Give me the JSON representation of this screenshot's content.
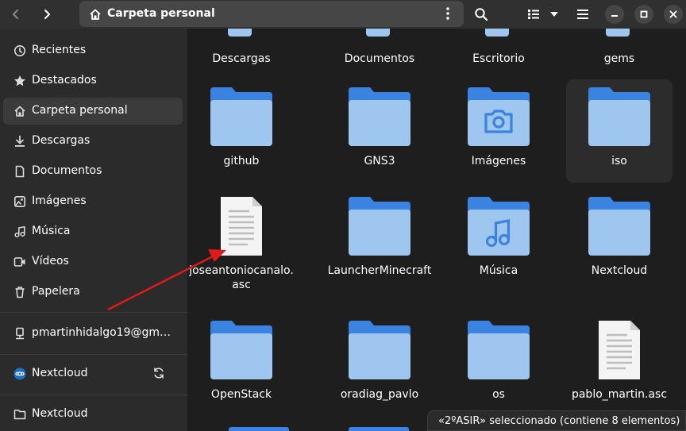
{
  "header": {
    "location_title": "Carpeta personal"
  },
  "sidebar": {
    "items": [
      {
        "label": "Recientes",
        "icon": "clock-icon"
      },
      {
        "label": "Destacados",
        "icon": "star-icon"
      },
      {
        "label": "Carpeta personal",
        "icon": "home-icon",
        "active": true
      },
      {
        "label": "Descargas",
        "icon": "download-icon"
      },
      {
        "label": "Documentos",
        "icon": "document-icon"
      },
      {
        "label": "Imágenes",
        "icon": "image-icon"
      },
      {
        "label": "Música",
        "icon": "music-icon"
      },
      {
        "label": "Vídeos",
        "icon": "video-icon"
      },
      {
        "label": "Papelera",
        "icon": "trash-icon"
      }
    ],
    "account_label": "pmartinhidalgo19@gma…",
    "nextcloud_label": "Nextcloud",
    "nextcloud_folder_label": "Nextcloud"
  },
  "files": {
    "top_row": [
      "Descargas",
      "Documentos",
      "Escritorio",
      "gems"
    ],
    "row1": [
      {
        "name": "github",
        "type": "folder"
      },
      {
        "name": "GNS3",
        "type": "folder"
      },
      {
        "name": "Imágenes",
        "type": "folder-pictures"
      },
      {
        "name": "iso",
        "type": "folder",
        "selected": true
      }
    ],
    "row2": [
      {
        "name": "joseantoniocanalo.asc",
        "type": "text-file"
      },
      {
        "name": "LauncherMinecraft",
        "type": "folder"
      },
      {
        "name": "Música",
        "type": "folder-music"
      },
      {
        "name": "Nextcloud",
        "type": "folder"
      }
    ],
    "row3": [
      {
        "name": "OpenStack",
        "type": "folder"
      },
      {
        "name": "oradiag_pavlo",
        "type": "folder"
      },
      {
        "name": "os",
        "type": "folder"
      },
      {
        "name": "pablo_martin.asc",
        "type": "text-file"
      }
    ]
  },
  "status": {
    "text": "«2ºASIR» seleccionado  (contiene 8 elementos)"
  },
  "colors": {
    "folder_front": "#9fc6ee",
    "folder_back": "#3b83e0",
    "annotation_arrow": "#e0191a"
  }
}
